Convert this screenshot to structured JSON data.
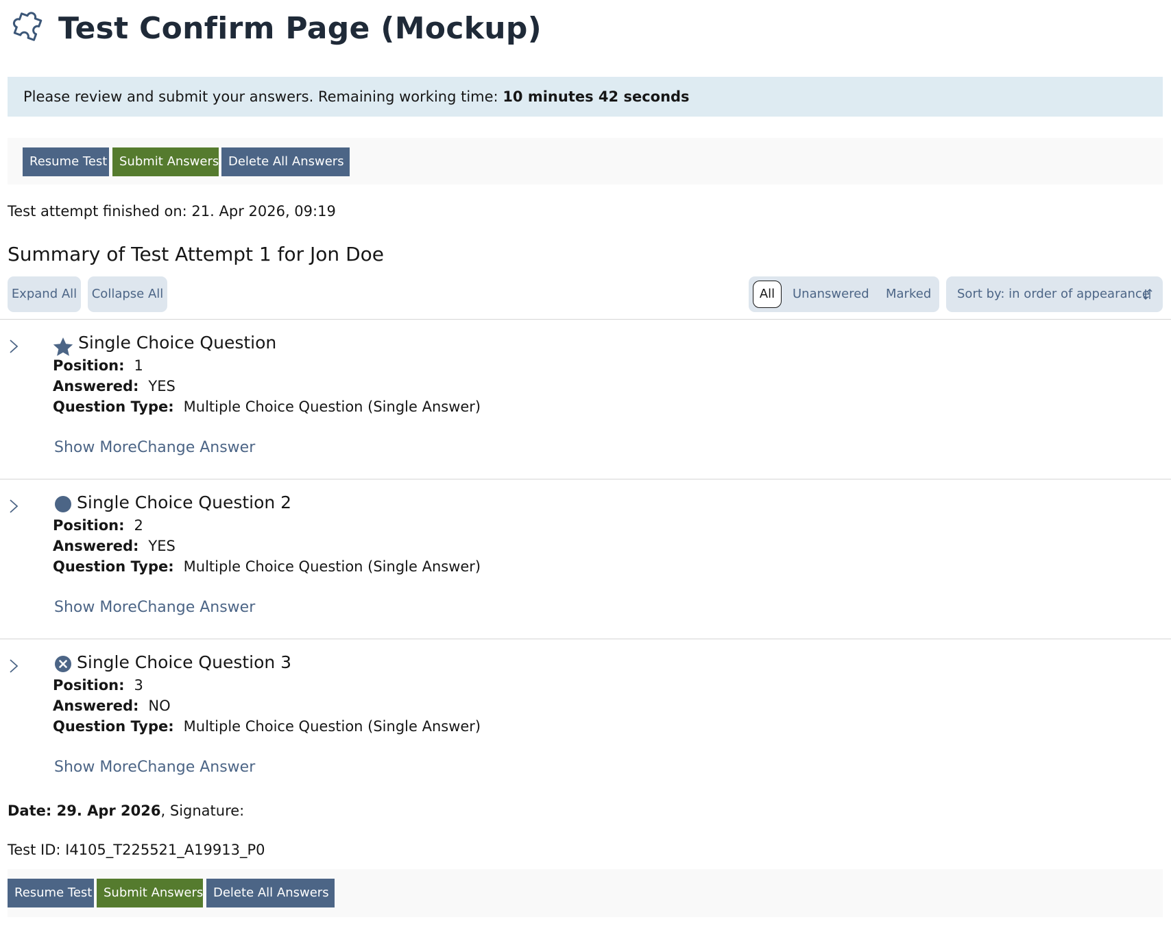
{
  "header": {
    "icon": "puzzle-piece-icon",
    "title": "Test Confirm Page (Mockup)"
  },
  "info": {
    "prefix": "Please review and submit your answers. Remaining working time:",
    "time": "10 minutes 42 seconds"
  },
  "toolbar": {
    "resume_label": "Resume Test",
    "submit_label": "Submit Answers",
    "delete_label": "Delete All Answers"
  },
  "finished_text": "Test attempt finished on: 21. Apr 2026, 09:19",
  "summary_title": "Summary of Test Attempt 1 for Jon Doe",
  "controls": {
    "expand_all": "Expand All",
    "collapse_all": "Collapse All",
    "filters": [
      "All",
      "Unanswered",
      "Marked"
    ],
    "sort_label": "Sort by: in order of appearance",
    "sort_icon": "sort-arrows-icon"
  },
  "property_labels": {
    "position": "Position:",
    "answered": "Answered:",
    "type": "Question Type:"
  },
  "questions": [
    {
      "title": "Single Choice Question",
      "status_icon": "star-icon",
      "position": "1",
      "answered": "YES",
      "type": "Multiple Choice Question (Single Answer)",
      "show_more": "Show More",
      "change_answer": "Change Answer"
    },
    {
      "title": "Single Choice Question 2",
      "status_icon": "filled-circle-icon",
      "position": "2",
      "answered": "YES",
      "type": "Multiple Choice Question (Single Answer)",
      "show_more": "Show More",
      "change_answer": "Change Answer"
    },
    {
      "title": "Single Choice Question 3",
      "status_icon": "x-circle-icon",
      "position": "3",
      "answered": "NO",
      "type": "Multiple Choice Question (Single Answer)",
      "show_more": "Show More",
      "change_answer": "Change Answer"
    }
  ],
  "footer": {
    "date_label": "Date: 29. Apr 2026",
    "signature_label": ", Signature:",
    "test_id": "Test ID: I4105_T225521_A19913_P0"
  },
  "colors": {
    "primary": "#557b2e",
    "default": "#4c6586",
    "info_bg": "#deebf2",
    "pill_bg": "#dee6ee"
  }
}
